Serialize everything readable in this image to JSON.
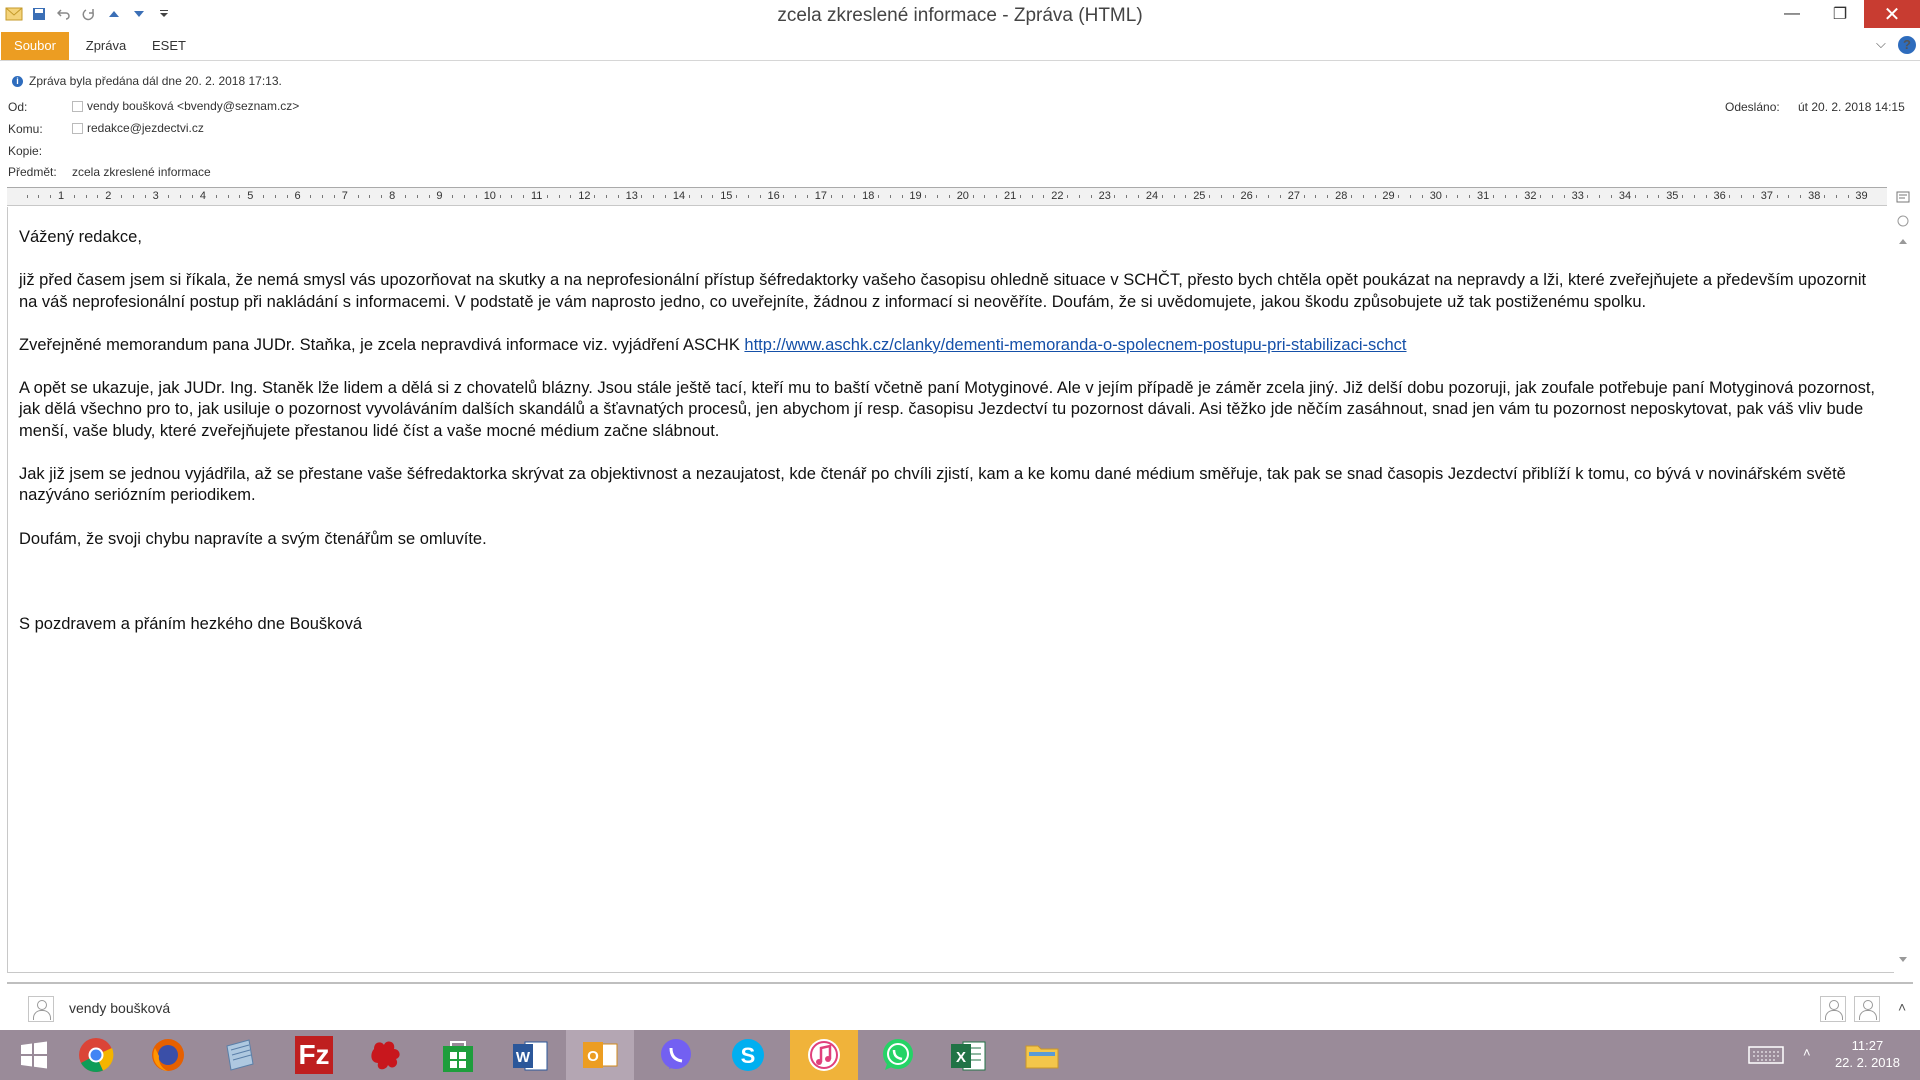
{
  "window": {
    "title": "zcela zkreslené informace  -  Zpráva (HTML)",
    "minimize_glyph": "—",
    "maximize_glyph": "❐",
    "close_glyph": "✕"
  },
  "quick_access": {
    "icons": [
      "envelope-icon",
      "save-icon",
      "undo-icon",
      "redo-icon",
      "previous-item-icon",
      "next-item-icon",
      "customize-icon"
    ]
  },
  "ribbon": {
    "tabs": [
      "Soubor",
      "Zpráva",
      "ESET"
    ],
    "active_tab": "Soubor",
    "collapse_glyph": "⌵",
    "help_glyph": "?"
  },
  "header": {
    "info_banner": "Zpráva byla předána dál dne 20. 2. 2018 17:13.",
    "from_label": "Od:",
    "from_value": "vendy boušková <bvendy@seznam.cz>",
    "to_label": "Komu:",
    "to_value": "redakce@jezdectvi.cz",
    "cc_label": "Kopie:",
    "cc_value": "",
    "subject_label": "Předmět:",
    "subject_value": "zcela zkreslené informace",
    "sent_label": "Odesláno:",
    "sent_value": "út 20. 2. 2018 14:15"
  },
  "ruler": {
    "numbers": [
      "1",
      "2",
      "3",
      "4",
      "5",
      "6",
      "7",
      "8",
      "9",
      "10",
      "11",
      "12",
      "13",
      "14",
      "15",
      "16",
      "17",
      "18",
      "19",
      "20",
      "21",
      "22",
      "23",
      "24",
      "25",
      "26",
      "27",
      "28",
      "29",
      "30",
      "31",
      "32",
      "33",
      "34",
      "35",
      "36",
      "37",
      "38",
      "39"
    ]
  },
  "message": {
    "greeting": "Vážený redakce,",
    "para1": "již před časem jsem si říkala, že nemá smysl vás upozorňovat na skutky a na neprofesionální přístup šéfredaktorky vašeho časopisu ohledně situace v SCHČT, přesto bych chtěla opět  poukázat na nepravdy a lži, které zveřejňujete a především upozornit na váš neprofesionální postup při nakládání s informacemi. V podstatě je vám naprosto jedno, co uveřejníte, žádnou z informací si neověříte. Doufám, že si uvědomujete, jakou škodu způsobujete už tak postiženému spolku.",
    "para2_text": "Zveřejněné memorandum pana JUDr. Staňka, je zcela nepravdivá informace viz. vyjádření ASCHK ",
    "para2_link": "http://www.aschk.cz/clanky/dementi-memoranda-o-spolecnem-postupu-pri-stabilizaci-schct",
    "para3": "A opět se ukazuje, jak JUDr. Ing. Staněk lže lidem a dělá si z chovatelů blázny. Jsou stále ještě tací, kteří mu to baští včetně paní Motyginové. Ale v jejím případě je záměr zcela jiný. Již delší dobu pozoruji, jak zoufale potřebuje paní Motyginová pozornost, jak dělá všechno pro to, jak usiluje o pozornost vyvoláváním dalších skandálů a šťavnatých procesů, jen abychom jí resp. časopisu Jezdectví tu pozornost dávali. Asi těžko jde něčím zasáhnout, snad jen vám tu pozornost neposkytovat, pak váš vliv bude menší, vaše bludy, které zveřejňujete přestanou lidé číst a vaše mocné médium začne slábnout.",
    "para4": "Jak již jsem se jednou vyjádřila, až se přestane vaše šéfredaktorka skrývat za objektivnost a nezaujatost, kde čtenář po chvíli zjistí, kam a ke komu dané médium směřuje, tak pak se snad časopis Jezdectví přiblíží k tomu, co bývá v novinářském světě nazýváno seriózním periodikem.",
    "para5": "Doufám, že svoji chybu napravíte a svým čtenářům se omluvíte.",
    "signature": "S pozdravem a přáním hezkého dne Boušková"
  },
  "people_pane": {
    "name": "vendy boušková",
    "expand_glyph": "˄"
  },
  "taskbar": {
    "apps": [
      "windows-start-icon",
      "chrome-icon",
      "firefox-icon",
      "notepad-icon",
      "filezilla-icon",
      "puzzle-icon",
      "store-icon",
      "word-icon",
      "outlook-icon",
      "viber-icon",
      "skype-icon",
      "itunes-icon",
      "whatsapp-icon",
      "excel-icon",
      "file-explorer-icon"
    ],
    "time": "11:27",
    "date": "22. 2. 2018",
    "tray_glyph": "˄"
  }
}
